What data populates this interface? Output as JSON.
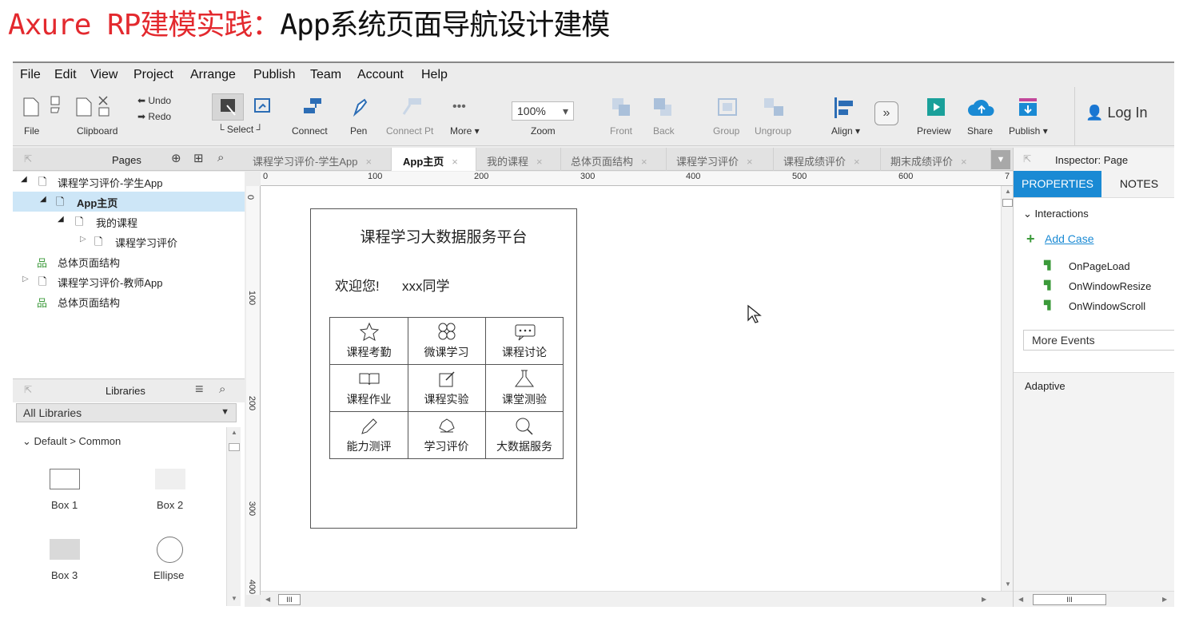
{
  "title": {
    "part_red": "Axure RP建模实践：",
    "part_black": "App系统页面导航设计建模"
  },
  "menu": [
    "File",
    "Edit",
    "View",
    "Project",
    "Arrange",
    "Publish",
    "Team",
    "Account",
    "Help"
  ],
  "toolbar": {
    "file": "File",
    "clipboard": "Clipboard",
    "undo": "Undo",
    "redo": "Redo",
    "select": "Select",
    "connect": "Connect",
    "pen": "Pen",
    "connect_pt": "Connect Pt",
    "more": "More ▾",
    "zoom_value": "100%",
    "zoom": "Zoom",
    "front": "Front",
    "back": "Back",
    "group": "Group",
    "ungroup": "Ungroup",
    "align": "Align ▾",
    "preview": "Preview",
    "share": "Share",
    "publish": "Publish ▾",
    "login": "Log In"
  },
  "pages_panel": {
    "title": "Pages",
    "items": [
      {
        "label": "课程学习评价-学生App",
        "arrow": "◢"
      },
      {
        "label": "App主页",
        "arrow": "◢"
      },
      {
        "label": "我的课程",
        "arrow": "◢"
      },
      {
        "label": "课程学习评价",
        "arrow": "▷"
      },
      {
        "label": "总体页面结构",
        "arrow": ""
      },
      {
        "label": "课程学习评价-教师App",
        "arrow": "▷"
      },
      {
        "label": "总体页面结构",
        "arrow": ""
      }
    ]
  },
  "libraries": {
    "title": "Libraries",
    "selected": "All Libraries",
    "group": "Default > Common",
    "widgets": [
      "Box 1",
      "Box 2",
      "Box 3",
      "Ellipse"
    ]
  },
  "tabs": [
    {
      "label": "课程学习评价-学生App",
      "close": "×"
    },
    {
      "label": "App主页",
      "close": "×"
    },
    {
      "label": "我的课程",
      "close": "×"
    },
    {
      "label": "总体页面结构",
      "close": "×"
    },
    {
      "label": "课程学习评价",
      "close": "×"
    },
    {
      "label": "课程成绩评价",
      "close": "×"
    },
    {
      "label": "期末成绩评价",
      "close": "×"
    }
  ],
  "ruler_h": [
    "0",
    "100",
    "200",
    "300",
    "400",
    "500",
    "600",
    "7"
  ],
  "ruler_v": [
    "0",
    "100",
    "200",
    "300",
    "400"
  ],
  "inspector": {
    "title": "Inspector: Page",
    "tab_properties": "PROPERTIES",
    "tab_notes": "NOTES",
    "interactions": "Interactions",
    "add_case": "Add Case",
    "events": [
      "OnPageLoad",
      "OnWindowResize",
      "OnWindowScroll"
    ],
    "more_events": "More Events",
    "adaptive": "Adaptive"
  },
  "phone": {
    "platform_title": "课程学习大数据服务平台",
    "welcome": "欢迎您!",
    "user": "xxx同学",
    "cells": [
      "课程考勤",
      "微课学习",
      "课程讨论",
      "课程作业",
      "课程实验",
      "课堂测验",
      "能力测评",
      "学习评价",
      "大数据服务"
    ]
  },
  "scroll_grip": "III",
  "colors": {
    "accent": "#1a8ad4",
    "title_red": "#e3292e",
    "selection": "#cde6f7",
    "green": "#3b9a3a"
  }
}
